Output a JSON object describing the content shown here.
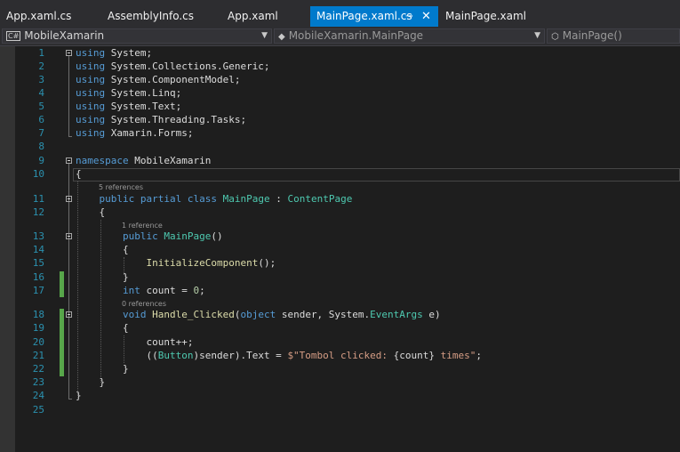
{
  "tabs": [
    {
      "label": "App.xaml.cs",
      "active": false
    },
    {
      "label": "AssemblyInfo.cs",
      "active": false
    },
    {
      "label": "App.xaml",
      "active": false
    },
    {
      "label": "MainPage.xaml.cs",
      "active": true
    },
    {
      "label": "MainPage.xaml",
      "active": false
    }
  ],
  "tab_icons": {
    "pin": "pin-icon",
    "close": "close-icon"
  },
  "nav": {
    "project": "MobileXamarin",
    "type": "MobileXamarin.MainPage",
    "member": "MainPage()",
    "icons": {
      "project": "csharp-project-icon",
      "type": "class-icon",
      "member": "method-icon",
      "dropdown": "chevron-down-icon"
    }
  },
  "code_lens": {
    "class_refs": "5 references",
    "ctor_refs": "1 reference",
    "handler_refs": "0 references"
  },
  "lines": {
    "l1": [
      "using",
      " System;"
    ],
    "l2": [
      "using",
      " System.Collections.Generic;"
    ],
    "l3": [
      "using",
      " System.ComponentModel;"
    ],
    "l4": [
      "using",
      " System.Linq;"
    ],
    "l5": [
      "using",
      " System.Text;"
    ],
    "l6": [
      "using",
      " System.Threading.Tasks;"
    ],
    "l7": [
      "using",
      " Xamarin.Forms;"
    ],
    "l9": [
      "namespace",
      " MobileXamarin"
    ],
    "l10": [
      "{"
    ],
    "l11": [
      "    ",
      "public",
      " ",
      "partial",
      " ",
      "class",
      " ",
      "MainPage",
      " : ",
      "ContentPage"
    ],
    "l12": [
      "    {"
    ],
    "l13": [
      "        ",
      "public",
      " ",
      "MainPage",
      "()"
    ],
    "l14": [
      "        {"
    ],
    "l15": [
      "            ",
      "InitializeComponent",
      "();"
    ],
    "l16": [
      "        }"
    ],
    "l17": [
      "        ",
      "int",
      " count = ",
      "0",
      ";"
    ],
    "l18": [
      "        ",
      "void",
      " ",
      "Handle_Clicked",
      "(",
      "object",
      " sender, System.",
      "EventArgs",
      " e)"
    ],
    "l19": [
      "        {"
    ],
    "l20": [
      "            count++;"
    ],
    "l21": [
      "            ((",
      "Button",
      ")sender).Text = ",
      "$\"Tombol clicked: ",
      "{count}",
      " times\"",
      ";"
    ],
    "l22": [
      "        }"
    ],
    "l23": [
      "    }"
    ],
    "l24": [
      "}"
    ]
  },
  "line_numbers": [
    "1",
    "2",
    "3",
    "4",
    "5",
    "6",
    "7",
    "8",
    "9",
    "10",
    "11",
    "12",
    "13",
    "14",
    "15",
    "16",
    "17",
    "18",
    "19",
    "20",
    "21",
    "22",
    "23",
    "24",
    "25"
  ],
  "colors": {
    "keyword": "#569cd6",
    "type": "#4ec9b0",
    "method": "#dcdcaa",
    "string": "#d69d85",
    "number": "#b5cea8",
    "line_number": "#2b91af",
    "active_tab": "#007acc",
    "changed_margin": "#57a64a"
  }
}
